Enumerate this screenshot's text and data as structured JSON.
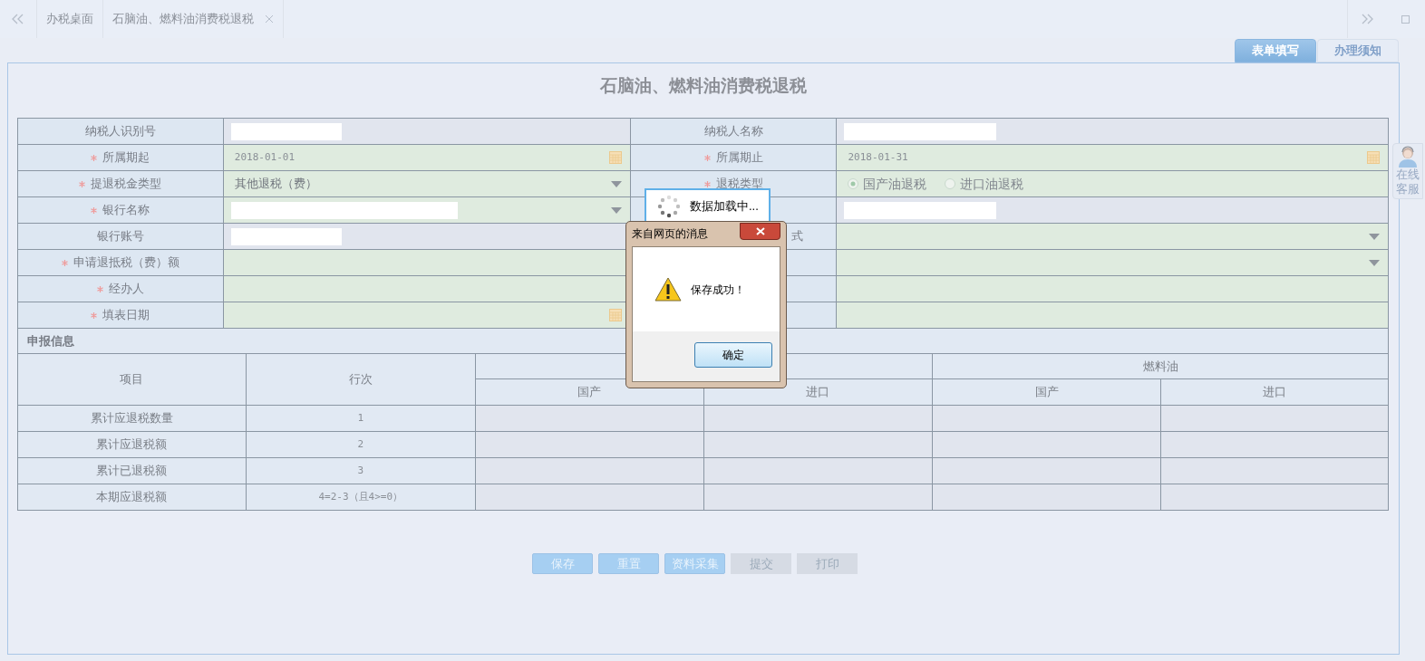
{
  "top_tabs": [
    {
      "label": "办税桌面",
      "closable": false
    },
    {
      "label": "石脑油、燃料油消费税退税",
      "closable": true
    }
  ],
  "form_tabs": [
    {
      "label": "表单填写",
      "selected": true
    },
    {
      "label": "办理须知",
      "selected": false
    }
  ],
  "title": "石脑油、燃料油消费税退税",
  "form_rows": [
    {
      "left": {
        "label": "纳税人识别号",
        "required": false,
        "editable": false,
        "kind": "masked"
      },
      "right": {
        "label": "纳税人名称",
        "required": false,
        "editable": false,
        "kind": "masked"
      }
    },
    {
      "left": {
        "label": "所属期起",
        "required": true,
        "editable": true,
        "kind": "date",
        "value": "2018-01-01"
      },
      "right": {
        "label": "所属期止",
        "required": true,
        "editable": true,
        "kind": "date",
        "value": "2018-01-31"
      }
    },
    {
      "left": {
        "label": "提退税金类型",
        "required": true,
        "editable": true,
        "kind": "select",
        "value": "其他退税（费）"
      },
      "right": {
        "label": "退税类型",
        "required": true,
        "editable": true,
        "kind": "radio",
        "options": [
          {
            "label": "国产油退税",
            "selected": true
          },
          {
            "label": "进口油退税",
            "selected": false
          }
        ]
      }
    },
    {
      "left": {
        "label": "银行名称",
        "required": true,
        "editable": true,
        "kind": "masked_select"
      },
      "right": {
        "editable": false,
        "kind": "masked"
      }
    },
    {
      "left": {
        "label": "银行账号",
        "required": false,
        "editable": false,
        "kind": "masked"
      },
      "right": {
        "label": "式",
        "editable": true,
        "kind": "select"
      }
    },
    {
      "left": {
        "label": "申请退抵税（费）额",
        "required": true,
        "editable": true,
        "kind": "text"
      },
      "right": {
        "editable": true,
        "kind": "select"
      }
    },
    {
      "left": {
        "label": "经办人",
        "required": true,
        "editable": true,
        "kind": "text"
      },
      "right": {
        "editable": true,
        "kind": "text"
      }
    },
    {
      "left": {
        "label": "填表日期",
        "required": true,
        "editable": true,
        "kind": "date"
      },
      "right": {
        "editable": true,
        "kind": "text"
      }
    }
  ],
  "section_title": "申报信息",
  "declaration_table": {
    "header": [
      {
        "label": "项目"
      },
      {
        "label": "行次"
      },
      {
        "subcolumns": [
          "国产",
          "进口"
        ]
      },
      {
        "label": "燃料油",
        "subcolumns": [
          "国产",
          "进口"
        ]
      }
    ],
    "rows": [
      {
        "item": "累计应退税数量",
        "line": "1"
      },
      {
        "item": "累计应退税额",
        "line": "2"
      },
      {
        "item": "累计已退税额",
        "line": "3"
      },
      {
        "item": "本期应退税额",
        "line": "4=2-3（且4>=0）"
      }
    ]
  },
  "buttons": [
    {
      "label": "保存",
      "disabled": false
    },
    {
      "label": "重置",
      "disabled": false
    },
    {
      "label": "资料采集",
      "disabled": false
    },
    {
      "label": "提交",
      "disabled": true
    },
    {
      "label": "打印",
      "disabled": true
    }
  ],
  "side_widget": {
    "label": "在线客服"
  },
  "loading": {
    "text": "数据加载中..."
  },
  "alert": {
    "title": "来自网页的消息",
    "message": "保存成功！",
    "button": "确定"
  }
}
